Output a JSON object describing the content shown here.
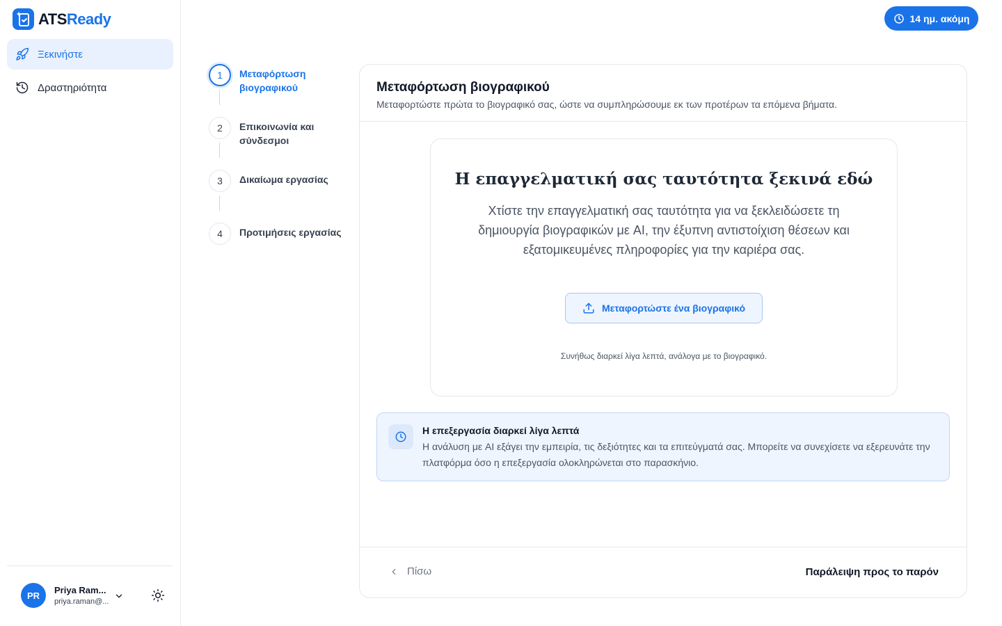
{
  "brand": {
    "name_part1": "ATS",
    "name_part2": "Ready",
    "color": "#1a73e8"
  },
  "sidebar": {
    "items": [
      {
        "label": "Ξεκινήστε",
        "icon": "rocket-icon",
        "active": true
      },
      {
        "label": "Δραστηριότητα",
        "icon": "history-icon",
        "active": false
      }
    ]
  },
  "user": {
    "initials": "PR",
    "name": "Priya Ram...",
    "email": "priya.raman@..."
  },
  "trial": {
    "label": "14 ημ. ακόμη",
    "icon": "clock-icon"
  },
  "stepper": {
    "steps": [
      {
        "number": "1",
        "label": "Μεταφόρτωση βιογραφικού",
        "active": true
      },
      {
        "number": "2",
        "label": "Επικοινωνία και σύνδεσμοι",
        "active": false
      },
      {
        "number": "3",
        "label": "Δικαίωμα εργασίας",
        "active": false
      },
      {
        "number": "4",
        "label": "Προτιμήσεις εργασίας",
        "active": false
      }
    ]
  },
  "card": {
    "title": "Μεταφόρτωση βιογραφικού",
    "subtitle": "Μεταφορτώστε πρώτα το βιογραφικό σας, ώστε να συμπληρώσουμε εκ των προτέρων τα επόμενα βήματα."
  },
  "hero": {
    "title": "Η επαγγελματική σας ταυτότητα ξεκινά εδώ",
    "description": "Χτίστε την επαγγελματική σας ταυτότητα για να ξεκλειδώσετε τη δημιουργία βιογραφικών με AI, την έξυπνη αντιστοίχιση θέσεων και εξατομικευμένες πληροφορίες για την καριέρα σας.",
    "upload_label": "Μεταφορτώστε ένα βιογραφικό",
    "note": "Συνήθως διαρκεί λίγα λεπτά, ανάλογα με το βιογραφικό."
  },
  "info": {
    "title": "Η επεξεργασία διαρκεί λίγα λεπτά",
    "text": "Η ανάλυση με AI εξάγει την εμπειρία, τις δεξιότητες και τα επιτεύγματά σας. Μπορείτε να συνεχίσετε να εξερευνάτε την πλατφόρμα όσο η επεξεργασία ολοκληρώνεται στο παρασκήνιο."
  },
  "footer": {
    "back_label": "Πίσω",
    "skip_label": "Παράλειψη προς το παρόν"
  }
}
